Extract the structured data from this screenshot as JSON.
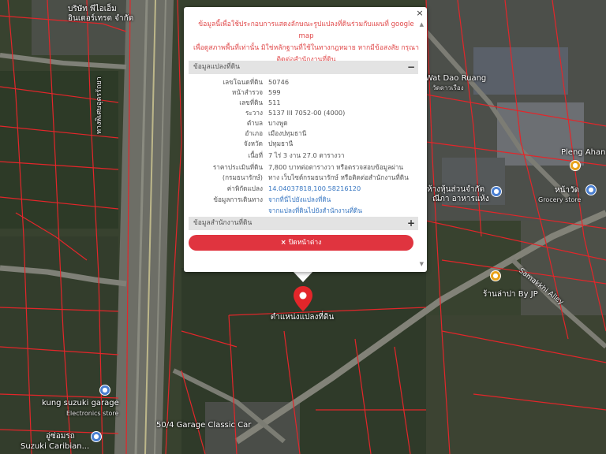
{
  "popup": {
    "disclaimer_line1": "ข้อมูลนี้เพื่อใช้ประกอบการแสดงลักษณะรูปแปลงที่ดินร่วมกับแผนที่ google map",
    "disclaimer_line2": "เพื่อดูสภาพพื้นที่เท่านั้น มิใช่หลักฐานที่ใช้ในทางกฎหมาย หากมีข้อสงสัย กรุณา",
    "disclaimer_line3": "ติดต่อสำนักงานที่ดิน",
    "section_parcel": "ข้อมูลแปลงที่ดิน",
    "section_parcel_toggle": "−",
    "section_office": "ข้อมูลสำนักงานที่ดิน",
    "section_office_toggle": "+",
    "close_button": "ปิดหน้าต่าง",
    "close_x": "×",
    "rows": [
      {
        "label": "เลขโฉนดที่ดิน",
        "value": "50746"
      },
      {
        "label": "หน้าสำรวจ",
        "value": "599"
      },
      {
        "label": "เลขที่ดิน",
        "value": "511"
      },
      {
        "label": "ระวาง",
        "value": "5137 III 7052-00 (4000)"
      },
      {
        "label": "ตำบล",
        "value": "บางพูด"
      },
      {
        "label": "อำเภอ",
        "value": "เมืองปทุมธานี"
      },
      {
        "label": "จังหวัด",
        "value": "ปทุมธานี"
      },
      {
        "label": "เนื้อที่",
        "value": "7 ไร่ 3 งาน 27.0 ตารางวา"
      }
    ],
    "price_label_1": "ราคาประเมินที่ดิน",
    "price_label_2": "(กรมธนารักษ์)",
    "price_value_1": "7,800 บาทต่อตารางวา หรือตรวจสอบข้อมูลผ่าน",
    "price_value_2": "ทาง เว็บไซต์กรมธนารักษ์ หรือติดต่อสำนักงานที่ดิน",
    "coord_label": "ค่าพิกัดแปลง",
    "coord_value": "14.04037818,100.58216120",
    "route_label": "ข้อมูลการเดินทาง",
    "route_value_1": "จากที่นี่ไปยังแปลงที่ดิน",
    "route_value_2": "จากแปลงที่ดินไปยังสำนักงานที่ดิน"
  },
  "map": {
    "pin_label": "ตำแหน่งแปลงที่ดิน",
    "labels": {
      "company": "บริษัท พีไอเอ็ม",
      "company2": "อินเตอร์เทรด จำกัด",
      "highway": "ทางพิเศษอุดรรัถยา",
      "wat": "Wat Dao Ruang",
      "wat_th": "วัดดาวเรือง",
      "pleng": "Pleng Ahan",
      "shop_th": "ห้างหุ้นส่วนจำกัด",
      "shop_th2": "ณีภา อาหารแห้ง",
      "grocery": "Grocery store",
      "grocery_th": "หน้าวัด",
      "samakkhi": "Samakkhi Alley",
      "restaurant": "ร้านล่าปา By JP",
      "kung": "kung suzuki garage",
      "kung_sub": "Electronics store",
      "garage": "50/4 Garage Classic Car",
      "suzuki_th": "อู่ซ่อมรถ",
      "suzuki": "Suzuki Caribian..."
    }
  },
  "colors": {
    "parcel_line": "#e3262a",
    "pin": "#e3262a",
    "close_button": "#e0343f",
    "disclaimer_text": "#e0494a",
    "link": "#3a78c2"
  }
}
